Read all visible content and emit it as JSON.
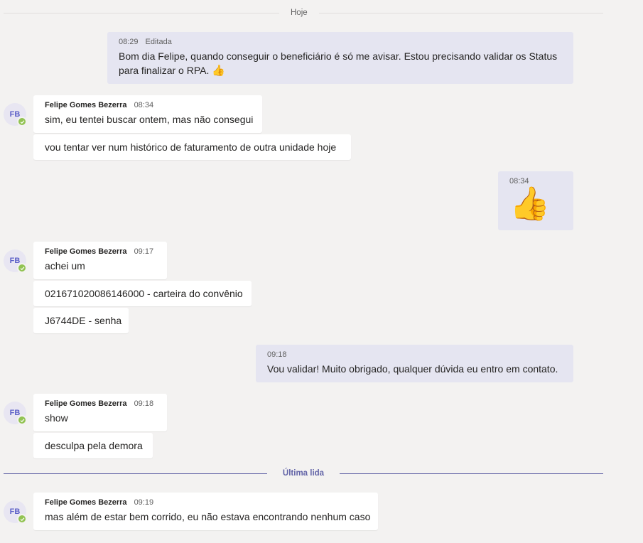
{
  "dividers": {
    "today": "Hoje",
    "last_read": "Última lida"
  },
  "colors": {
    "accent": "#6264a7",
    "own_bubble": "#e5e5f1",
    "other_bubble": "#ffffff",
    "presence_available": "#92c353"
  },
  "avatar": {
    "initials": "FB",
    "presence_icon": "check-icon"
  },
  "messages": {
    "m1": {
      "time": "08:29",
      "edited": "Editada",
      "text": "Bom dia Felipe, quando conseguir o beneficiário é só me avisar. Estou precisando validar os Status para finalizar o RPA.",
      "emoji": "👍"
    },
    "g1": {
      "sender": "Felipe Gomes Bezerra",
      "time": "08:34",
      "lines": [
        "sim, eu tentei buscar ontem, mas não consegui",
        "vou tentar ver num histórico de faturamento de outra unidade hoje"
      ]
    },
    "m2": {
      "time": "08:34",
      "emoji": "👍"
    },
    "g2": {
      "sender": "Felipe Gomes Bezerra",
      "time": "09:17",
      "lines": [
        "achei um",
        "021671020086146000 - carteira do convênio",
        "J6744DE - senha"
      ]
    },
    "m3": {
      "time": "09:18",
      "text": "Vou validar! Muito obrigado, qualquer dúvida eu entro em contato."
    },
    "g3": {
      "sender": "Felipe Gomes Bezerra",
      "time": "09:18",
      "lines": [
        "show",
        "desculpa pela demora"
      ]
    },
    "g4": {
      "sender": "Felipe Gomes Bezerra",
      "time": "09:19",
      "lines": [
        "mas além de estar bem corrido, eu não estava encontrando nenhum caso"
      ]
    }
  }
}
